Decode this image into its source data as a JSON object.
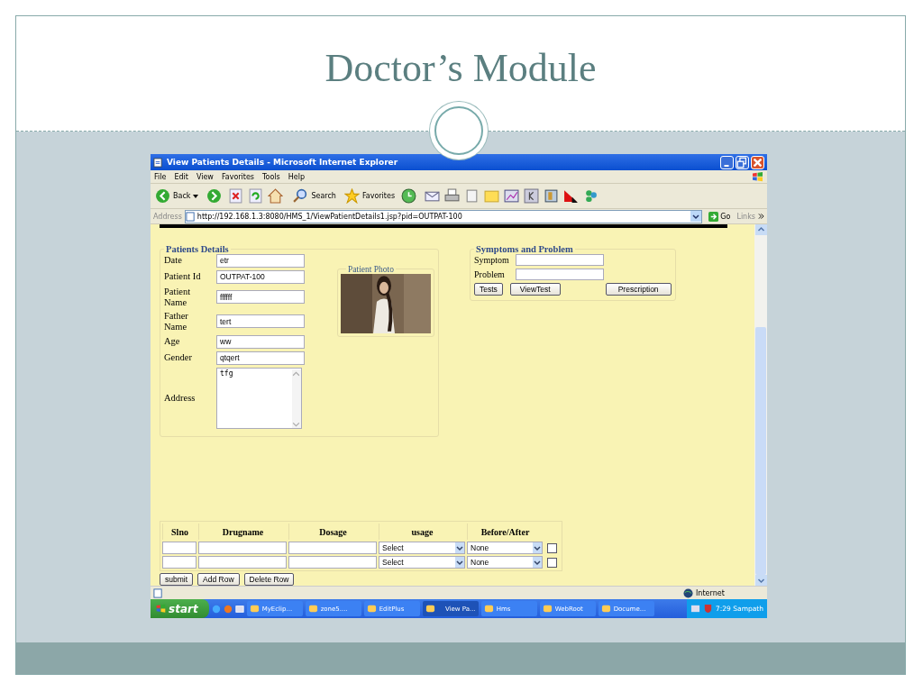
{
  "slide": {
    "title": "Doctor’s Module"
  },
  "window": {
    "title": "View Patients Details - Microsoft Internet Explorer"
  },
  "menu": [
    "File",
    "Edit",
    "View",
    "Favorites",
    "Tools",
    "Help"
  ],
  "toolbar": {
    "back": "Back",
    "search": "Search",
    "favorites": "Favorites"
  },
  "address_bar": {
    "label": "Address",
    "url": "http://192.168.1.3:8080/HMS_1/ViewPatientDetails1.jsp?pid=OUTPAT-100",
    "go": "Go",
    "links": "Links"
  },
  "patient_details": {
    "legend": "Patients Details",
    "fields": [
      {
        "label": "Date",
        "value": "etr",
        "kind": "input"
      },
      {
        "label": "Patient Id",
        "value": "OUTPAT-100",
        "kind": "input"
      },
      {
        "label": "Patient Name",
        "value": "ffffff",
        "kind": "input"
      },
      {
        "label": "Father Name",
        "value": "tert",
        "kind": "input"
      },
      {
        "label": "Age",
        "value": "ww",
        "kind": "input"
      },
      {
        "label": "Gender",
        "value": "qtqert",
        "kind": "input"
      },
      {
        "label": "Address",
        "value": "tfg",
        "kind": "textarea"
      }
    ]
  },
  "photo": {
    "legend": "Patient Photo"
  },
  "symptoms": {
    "legend": "Symptoms and Problem",
    "fields": [
      {
        "label": "Symptom"
      },
      {
        "label": "Problem"
      }
    ],
    "buttons": [
      "Tests",
      "ViewTest",
      "Prescription"
    ]
  },
  "prescription": {
    "columns": [
      "Slno",
      "Drugname",
      "Dosage",
      "usage",
      "Before/After"
    ],
    "rows": [
      {
        "usage": "Select",
        "timing": "None",
        "checked": false
      },
      {
        "usage": "Select",
        "timing": "None",
        "checked": false
      }
    ],
    "buttons": [
      "submit",
      "Add Row",
      "Delete Row"
    ]
  },
  "status_bar": {
    "zone": "Internet"
  },
  "taskbar": {
    "start": "start",
    "items": [
      {
        "label": "MyEclip...",
        "selected": false
      },
      {
        "label": "zone5....",
        "selected": false
      },
      {
        "label": "EditPlus",
        "selected": false
      },
      {
        "label": "View Pa...",
        "selected": true
      },
      {
        "label": "Hms",
        "selected": false
      },
      {
        "label": "WebRoot",
        "selected": false
      },
      {
        "label": "Docume...",
        "selected": false
      }
    ],
    "clock": "7:29 Sampath"
  }
}
